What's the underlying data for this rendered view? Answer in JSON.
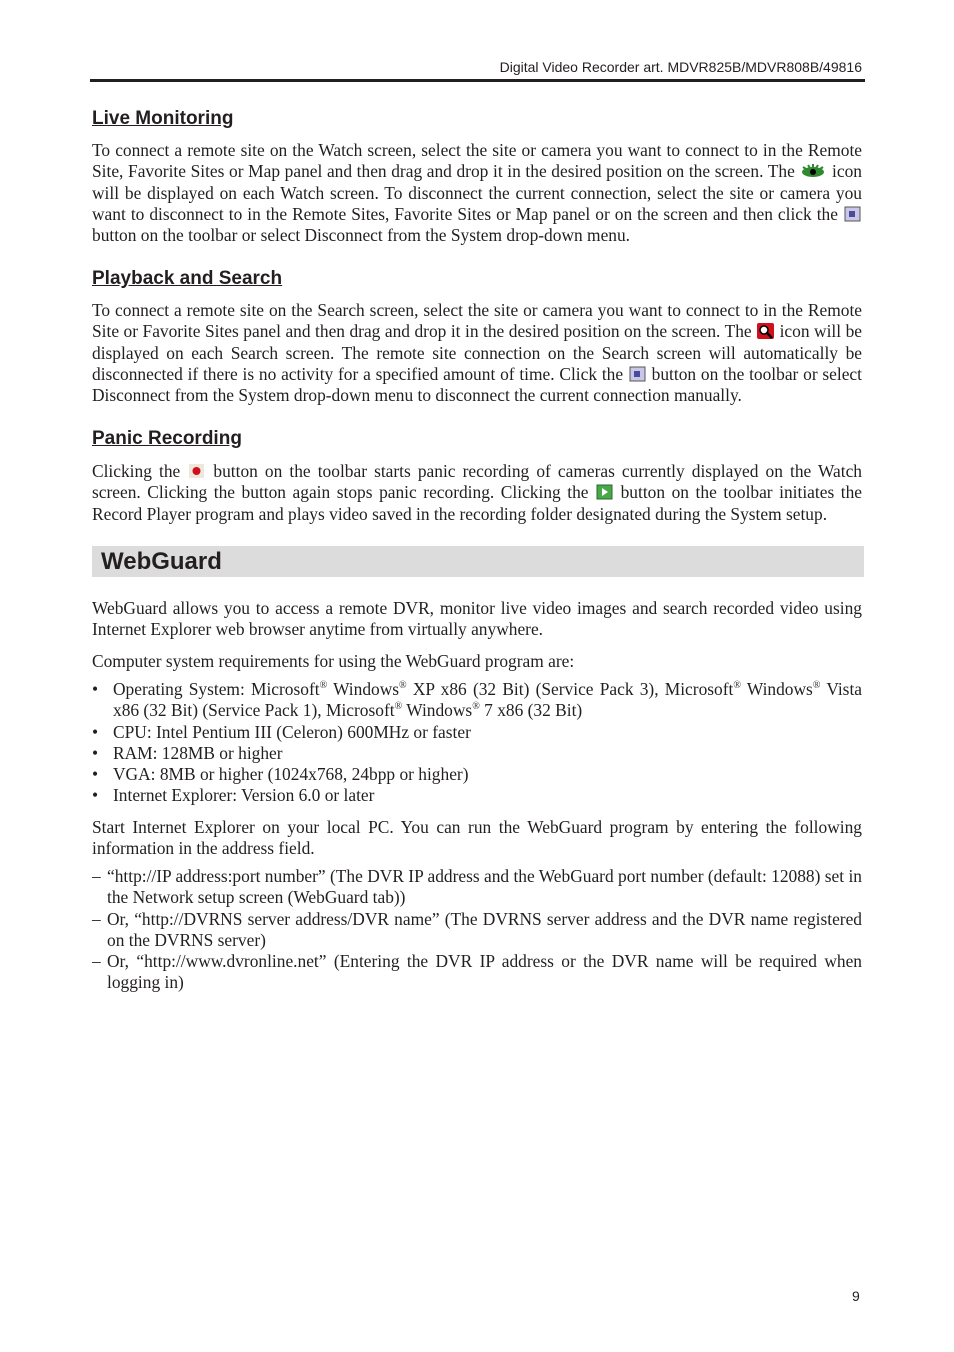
{
  "header": "Digital Video Recorder art. MDVR825B/MDVR808B/49816",
  "reg": "®",
  "live": {
    "title": "Live Monitoring",
    "t1": "To connect a remote site on the Watch screen, select the site or camera you want to connect to in the Remote Site, Favorite Sites or Map panel and then drag and drop it in the desired position on the screen.  The ",
    "t2": " icon will be displayed on each Watch screen.  To disconnect the current connection, select the site or camera you want to disconnect to in the Remote Sites, Favorite Sites or Map panel or on the screen and then click the ",
    "t3": " button on the toolbar or select Disconnect from the System drop-down menu."
  },
  "playback": {
    "title": "Playback and Search",
    "t1": "To connect a remote site on the Search screen, select the site or camera you want to connect to in the Remote Site or Favorite Sites panel and then drag and drop it in the desired position on the screen.  The ",
    "t2": " icon will be displayed on each Search screen.  The remote site connection on the Search screen will automatically be disconnected if there is no activity for a specified amount of time.  Click the ",
    "t3": " button on the toolbar or select Disconnect from the System drop-down menu to disconnect the current connection manually."
  },
  "panic": {
    "title": "Panic Recording",
    "t1": "Clicking the ",
    "t2": " button on the toolbar starts panic recording of cameras currently displayed on the Watch screen.  Clicking the button again stops panic recording.  Clicking the ",
    "t3": " button on the toolbar initiates the Record Player program and plays video saved in the recording folder designated during the System setup."
  },
  "webguard": {
    "title": "WebGuard",
    "intro": "WebGuard allows you to access a remote DVR, monitor live video images and search recorded video using Internet Explorer web browser anytime from virtually anywhere.",
    "req": "Computer system requirements for using the WebGuard program are:",
    "os": [
      "Operating System: Microsoft",
      " Windows",
      " XP x86 (32 Bit) (Service Pack 3), Microsoft",
      " Windows",
      " Vista x86 (32 Bit) (Service Pack 1), Microsoft",
      " Windows",
      " 7 x86 (32 Bit)"
    ],
    "reqs": [
      "CPU: Intel Pentium III (Celeron) 600MHz or faster",
      "RAM: 128MB or higher",
      "VGA: 8MB or higher (1024x768, 24bpp or higher)",
      "Internet Explorer: Version 6.0 or later"
    ],
    "start": "Start Internet Explorer on your local PC.  You can run the WebGuard program by entering the following information in the address field.",
    "addresses": [
      "“http://IP address:port number” (The DVR IP address and the WebGuard port number (default: 12088) set in the Network setup screen (WebGuard tab))",
      "Or, “http://DVRNS server address/DVR name” (The DVRNS server address and the DVR name registered on the DVRNS server)",
      "Or, “http://www.dvronline.net” (Entering the DVR IP address or the DVR name will be required when logging in)"
    ]
  },
  "page_number": "9"
}
